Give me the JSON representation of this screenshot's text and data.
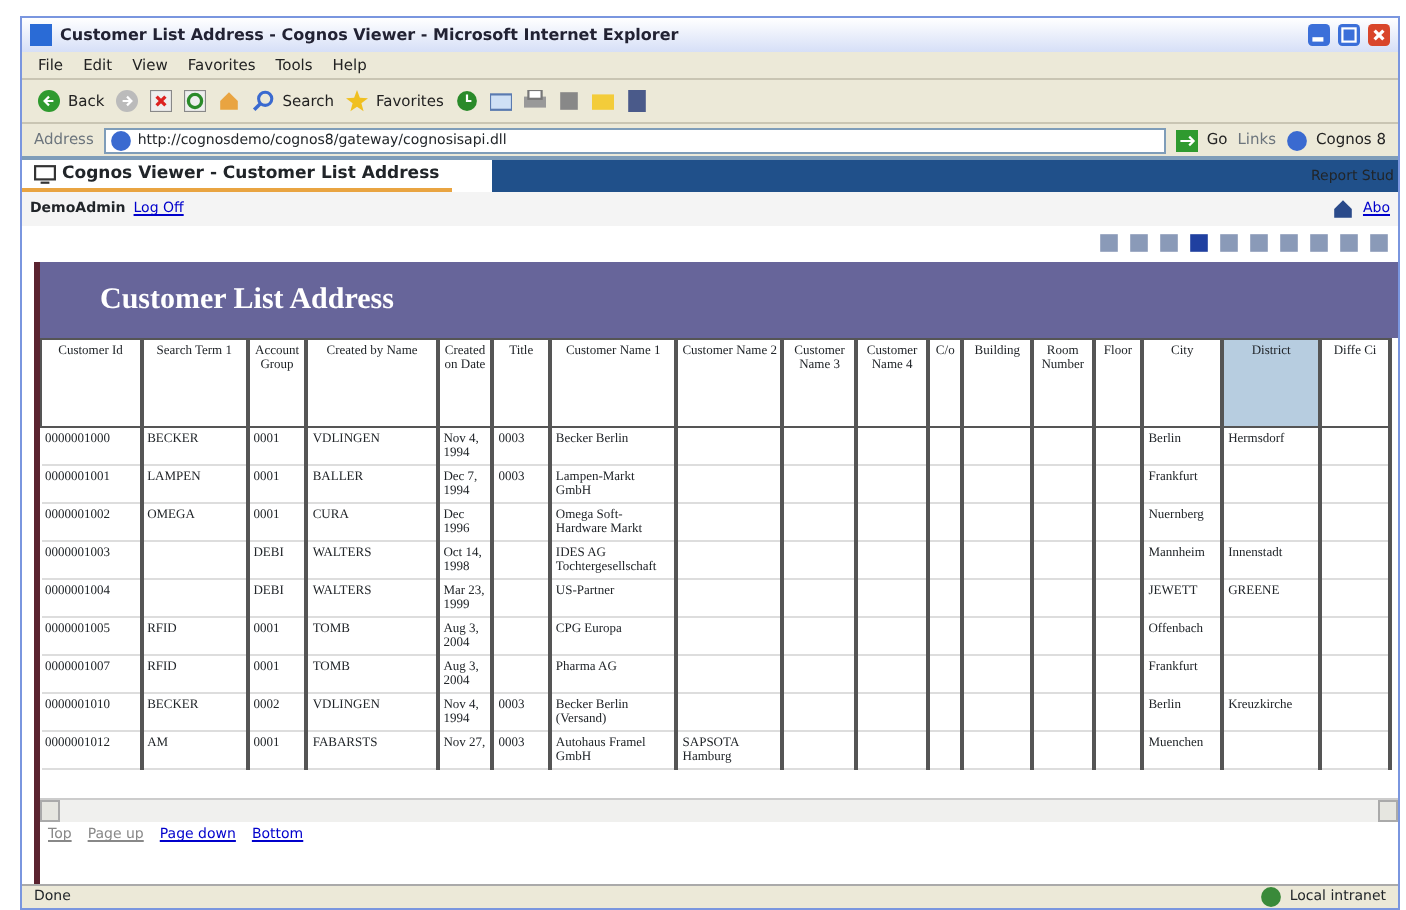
{
  "window": {
    "title": "Customer List Address - Cognos Viewer - Microsoft Internet Explorer"
  },
  "menu": [
    "File",
    "Edit",
    "View",
    "Favorites",
    "Tools",
    "Help"
  ],
  "toolbar": {
    "back": "Back",
    "search": "Search",
    "favorites": "Favorites"
  },
  "address": {
    "label": "Address",
    "value": "http://cognosdemo/cognos8/gateway/cognosisapi.dll",
    "go": "Go",
    "links": "Links",
    "link": "Cognos 8"
  },
  "app": {
    "tab": "Cognos Viewer - Customer List Address",
    "report_studio": "Report Stud",
    "user": "DemoAdmin",
    "logoff": "Log Off",
    "about": "Abo"
  },
  "report": {
    "title": "Customer List Address",
    "columns": [
      {
        "label": "Customer Id",
        "selected": false
      },
      {
        "label": "Search Term 1",
        "selected": false
      },
      {
        "label": "Account Group",
        "selected": false
      },
      {
        "label": "Created by Name",
        "selected": false
      },
      {
        "label": "Created on Date",
        "selected": false
      },
      {
        "label": "Title",
        "selected": false
      },
      {
        "label": "Customer Name 1",
        "selected": false
      },
      {
        "label": "Customer Name 2",
        "selected": false
      },
      {
        "label": "Customer Name 3",
        "selected": false
      },
      {
        "label": "Customer Name 4",
        "selected": false
      },
      {
        "label": "C/o",
        "selected": false
      },
      {
        "label": "Building",
        "selected": false
      },
      {
        "label": "Room Number",
        "selected": false
      },
      {
        "label": "Floor",
        "selected": false
      },
      {
        "label": "City",
        "selected": false
      },
      {
        "label": "District",
        "selected": true
      },
      {
        "label": "Diffe Ci",
        "selected": false
      }
    ],
    "rows": [
      {
        "cells": [
          "0000001000",
          "BECKER",
          "0001",
          "VDLINGEN",
          "Nov 4, 1994",
          "0003",
          "Becker Berlin",
          "",
          "",
          "",
          "",
          "",
          "",
          "",
          "Berlin",
          "Hermsdorf",
          ""
        ]
      },
      {
        "cells": [
          "0000001001",
          "LAMPEN",
          "0001",
          "BALLER",
          "Dec 7, 1994",
          "0003",
          "Lampen-Markt GmbH",
          "",
          "",
          "",
          "",
          "",
          "",
          "",
          "Frankfurt",
          "",
          ""
        ]
      },
      {
        "cells": [
          "0000001002",
          "OMEGA",
          "0001",
          "CURA",
          "Dec 1996",
          "",
          "Omega Soft-Hardware Markt",
          "",
          "",
          "",
          "",
          "",
          "",
          "",
          "Nuernberg",
          "",
          ""
        ]
      },
      {
        "cells": [
          "0000001003",
          "",
          "DEBI",
          "WALTERS",
          "Oct 14, 1998",
          "",
          "IDES AG Tochtergesellschaft",
          "",
          "",
          "",
          "",
          "",
          "",
          "",
          "Mannheim",
          "Innenstadt",
          ""
        ]
      },
      {
        "cells": [
          "0000001004",
          "",
          "DEBI",
          "WALTERS",
          "Mar 23, 1999",
          "",
          "US-Partner",
          "",
          "",
          "",
          "",
          "",
          "",
          "",
          "JEWETT",
          "GREENE",
          ""
        ]
      },
      {
        "cells": [
          "0000001005",
          "RFID",
          "0001",
          "TOMB",
          "Aug 3, 2004",
          "",
          "CPG Europa",
          "",
          "",
          "",
          "",
          "",
          "",
          "",
          "Offenbach",
          "",
          ""
        ]
      },
      {
        "cells": [
          "0000001007",
          "RFID",
          "0001",
          "TOMB",
          "Aug 3, 2004",
          "",
          "Pharma AG",
          "",
          "",
          "",
          "",
          "",
          "",
          "",
          "Frankfurt",
          "",
          ""
        ]
      },
      {
        "cells": [
          "0000001010",
          "BECKER",
          "0002",
          "VDLINGEN",
          "Nov 4, 1994",
          "0003",
          "Becker Berlin (Versand)",
          "",
          "",
          "",
          "",
          "",
          "",
          "",
          "Berlin",
          "Kreuzkirche",
          ""
        ]
      },
      {
        "cells": [
          "0000001012",
          "AM",
          "0001",
          "FABARSTS",
          "Nov 27,",
          "0003",
          "Autohaus Framel GmbH",
          "SAPSOTA Hamburg",
          "",
          "",
          "",
          "",
          "",
          "",
          "Muenchen",
          "",
          ""
        ]
      }
    ]
  },
  "pager": [
    {
      "label": "Top",
      "disabled": true
    },
    {
      "label": "Page up",
      "disabled": true
    },
    {
      "label": "Page down",
      "disabled": false
    },
    {
      "label": "Bottom",
      "disabled": false
    }
  ],
  "status": {
    "text": "Done",
    "zone": "Local intranet"
  }
}
